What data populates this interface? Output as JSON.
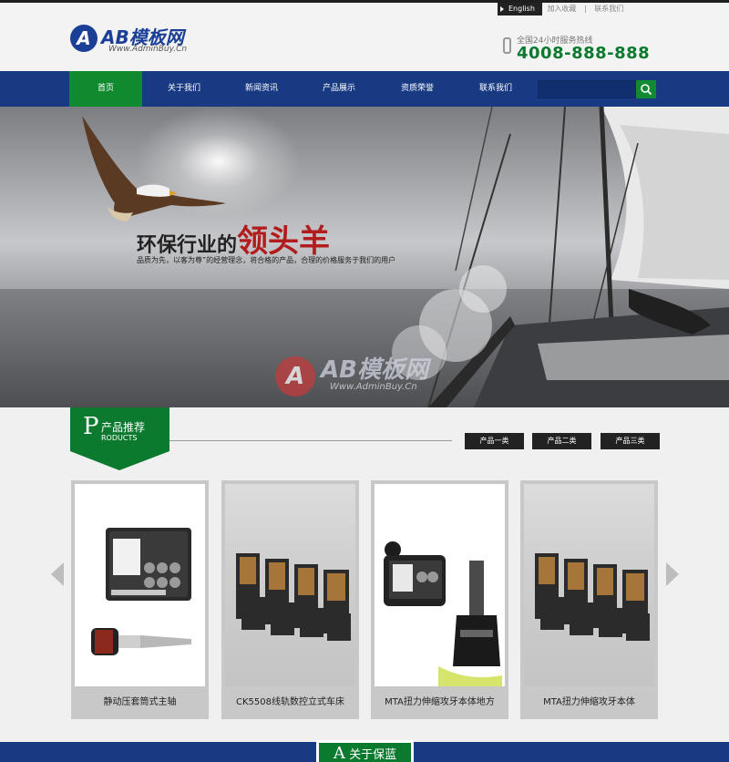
{
  "header": {
    "logo_mark": "A",
    "logo_text": "AB模板网",
    "logo_sub": "Www.AdminBuy.Cn",
    "toplinks": {
      "english": "English",
      "favorite": "加入收藏",
      "contact": "联系我们",
      "sep": "|"
    },
    "hotline_label": "全国24小时服务热线",
    "hotline_number": "4008-888-888"
  },
  "nav": {
    "items": [
      {
        "label": "首页",
        "active": true
      },
      {
        "label": "关于我们",
        "active": false
      },
      {
        "label": "新闻资讯",
        "active": false
      },
      {
        "label": "产品展示",
        "active": false
      },
      {
        "label": "资质荣誉",
        "active": false
      },
      {
        "label": "联系我们",
        "active": false
      }
    ],
    "search_placeholder": ""
  },
  "banner": {
    "slogan_part1": "环保行业的",
    "slogan_part2": "领头羊",
    "description": "品质为先，以客为尊”的经营理念，将合格的产品，合理的价格服务于我们的用户",
    "watermark_text": "AB模板网",
    "watermark_sub": "Www.AdminBuy.Cn",
    "watermark_mark": "A"
  },
  "products_section": {
    "tag_letter": "P",
    "tag_title": "产品推荐",
    "tag_en": "RODUCTS",
    "category_tabs": [
      "产品一类",
      "产品二类",
      "产品三类"
    ],
    "items": [
      {
        "caption": "静动压套筒式主轴"
      },
      {
        "caption": "CK5508线轨数控立式车床"
      },
      {
        "caption": "MTA扭力伸缩攻牙本体地方"
      },
      {
        "caption": "MTA扭力伸缩攻牙本体"
      }
    ]
  },
  "about_section": {
    "letter": "A",
    "title": "关于保蓝"
  },
  "colors": {
    "nav_blue": "#173a83",
    "brand_green": "#0c7a2e",
    "hotline_green": "#0b7a2f",
    "slogan_red": "#b21c1c"
  }
}
